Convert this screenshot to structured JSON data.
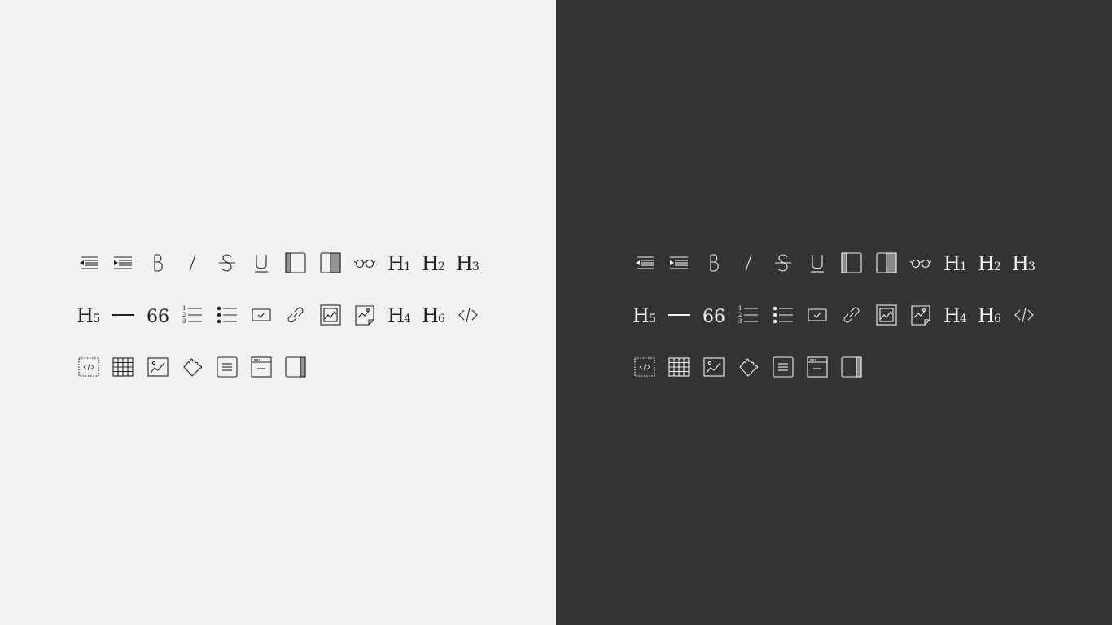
{
  "headings": {
    "h1": {
      "letter": "H",
      "sub": "1"
    },
    "h2": {
      "letter": "H",
      "sub": "2"
    },
    "h3": {
      "letter": "H",
      "sub": "3"
    },
    "h4": {
      "letter": "H",
      "sub": "4"
    },
    "h5": {
      "letter": "H",
      "sub": "5"
    },
    "h6": {
      "letter": "H",
      "sub": "6"
    }
  },
  "quote_glyph": "66",
  "ordered_list_numbers": [
    "1",
    "2",
    "3"
  ],
  "themes": [
    {
      "name": "light",
      "background": "#f1f1f1",
      "foreground": "#222222"
    },
    {
      "name": "dark",
      "background": "#333333",
      "foreground": "#f2f2f2"
    }
  ],
  "toolbar_rows": [
    [
      "outdent-icon",
      "indent-icon",
      "bold-icon",
      "italic-icon",
      "strikethrough-icon",
      "underline-icon",
      "left-panel-icon",
      "right-panel-icon",
      "preview-glasses-icon",
      "heading-1-icon",
      "heading-2-icon",
      "heading-3-icon"
    ],
    [
      "heading-5-icon",
      "horizontal-rule-icon",
      "blockquote-icon",
      "ordered-list-icon",
      "unordered-list-icon",
      "checkbox-icon",
      "link-icon",
      "image-icon",
      "image-file-icon",
      "heading-4-icon",
      "heading-6-icon",
      "code-icon"
    ],
    [
      "code-block-icon",
      "table-icon",
      "picture-icon",
      "emoji-hand-icon",
      "align-text-icon",
      "window-icon",
      "sidebar-icon"
    ]
  ]
}
